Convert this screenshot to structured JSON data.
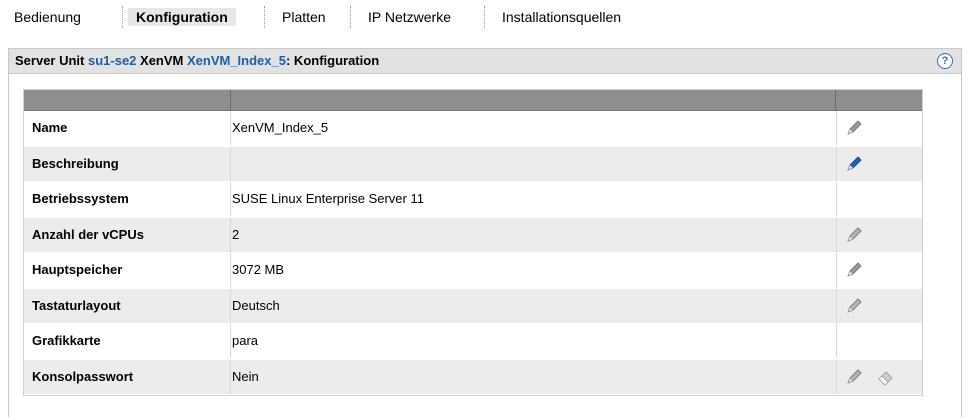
{
  "tabs": [
    {
      "label": "Bedienung",
      "active": false
    },
    {
      "label": "Konfiguration",
      "active": true
    },
    {
      "label": "Platten",
      "active": false
    },
    {
      "label": "IP Netzwerke",
      "active": false
    },
    {
      "label": "Installationsquellen",
      "active": false
    }
  ],
  "panel": {
    "title_prefix": "Server Unit ",
    "server_link": "su1-se2",
    "title_mid": " XenVM ",
    "vm_link": "XenVM_Index_5",
    "title_suffix": ": Konfiguration",
    "help_icon": "?"
  },
  "rows": [
    {
      "label": "Name",
      "value": "XenVM_Index_5",
      "edit": "grey"
    },
    {
      "label": "Beschreibung",
      "value": "",
      "edit": "blue"
    },
    {
      "label": "Betriebssystem",
      "value": "SUSE Linux Enterprise Server 11",
      "edit": "none"
    },
    {
      "label": "Anzahl der vCPUs",
      "value": "2",
      "edit": "light"
    },
    {
      "label": "Hauptspeicher",
      "value": "3072 MB",
      "edit": "grey"
    },
    {
      "label": "Tastaturlayout",
      "value": "Deutsch",
      "edit": "light"
    },
    {
      "label": "Grafikkarte",
      "value": "para",
      "edit": "none"
    },
    {
      "label": "Konsolpasswort",
      "value": "Nein",
      "edit": "light",
      "erase": true
    }
  ],
  "colors": {
    "accent_link": "#1d5fa4",
    "header_bg": "#e2e2e2",
    "table_head": "#8e8e8e",
    "row_alt": "#ececec"
  },
  "icons": {
    "edit": "pencil-icon",
    "erase": "eraser-icon",
    "help": "help-icon"
  }
}
